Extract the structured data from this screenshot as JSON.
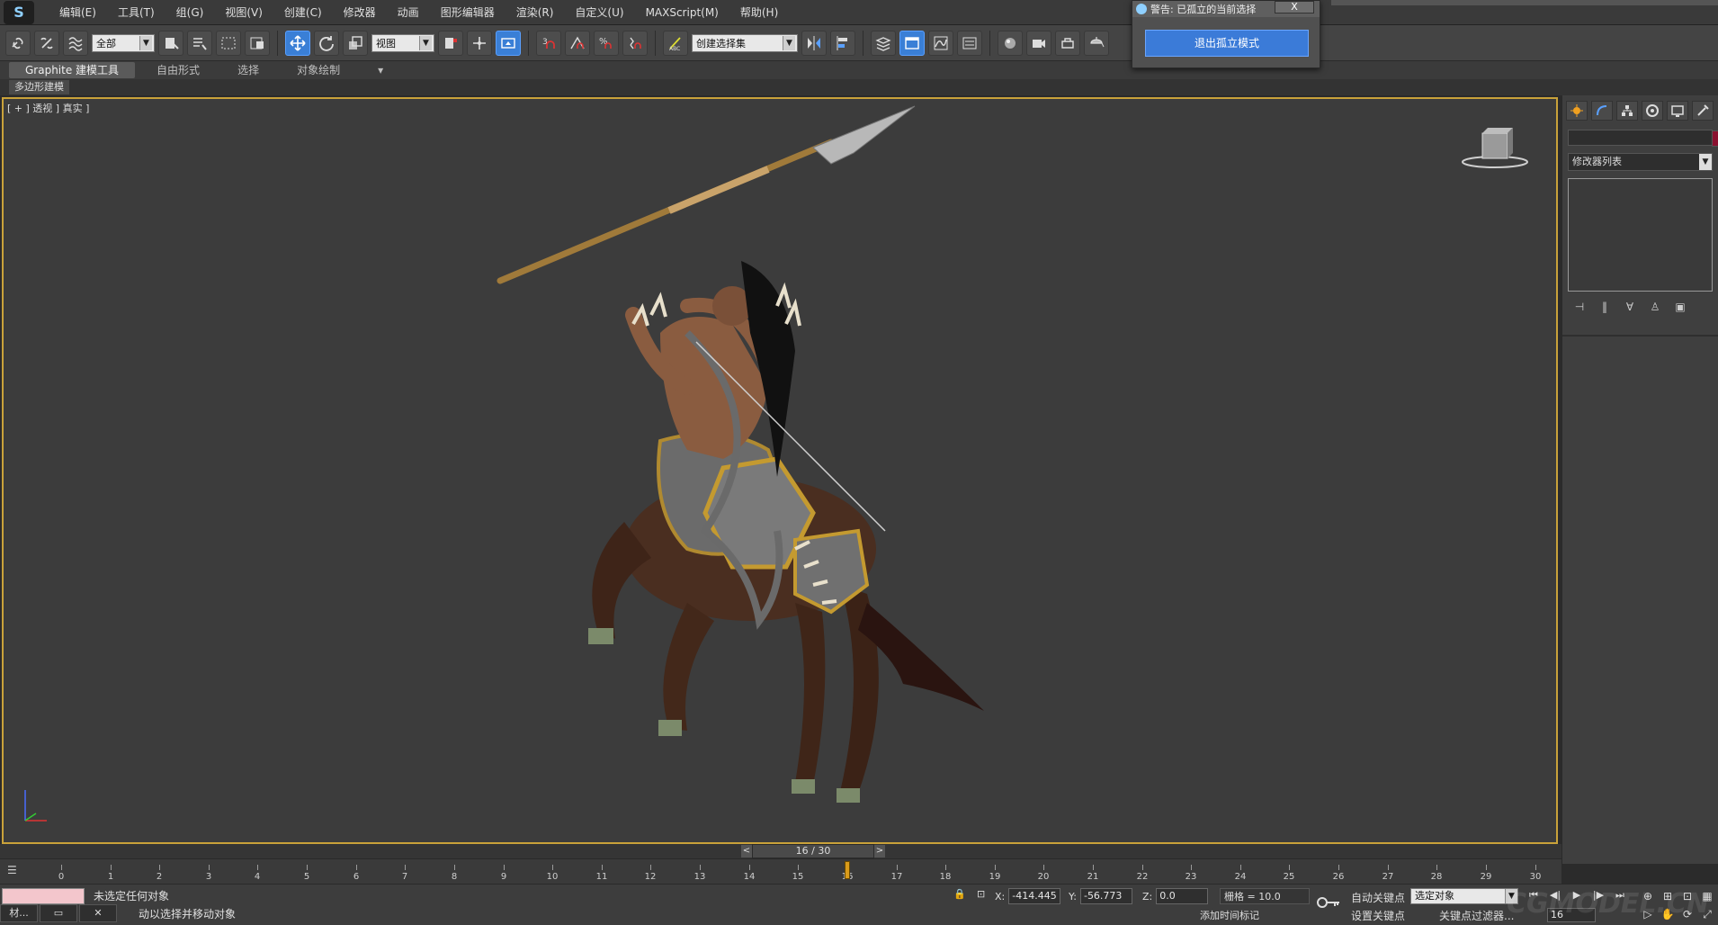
{
  "menu": {
    "items": [
      "编辑(E)",
      "工具(T)",
      "组(G)",
      "视图(V)",
      "创建(C)",
      "修改器",
      "动画",
      "图形编辑器",
      "渲染(R)",
      "自定义(U)",
      "MAXScript(M)",
      "帮助(H)"
    ]
  },
  "toolbar": {
    "selection_filter": "全部",
    "ref_coord": "视图",
    "named_selection": "创建选择集"
  },
  "ribbon": {
    "tabs": [
      "Graphite 建模工具",
      "自由形式",
      "选择",
      "对象绘制"
    ],
    "sub_label": "多边形建模"
  },
  "viewport": {
    "label": "[ + ] 透视 ] 真实 ]"
  },
  "dialog": {
    "title": "警告: 已孤立的当前选择",
    "close": "X",
    "button": "退出孤立模式"
  },
  "command_panel": {
    "modifier_list": "修改器列表"
  },
  "timeslider": {
    "frame_display": "16 / 30",
    "prev": "<",
    "next": ">",
    "current_frame": 16
  },
  "track": {
    "ticks": [
      "0",
      "1",
      "2",
      "3",
      "4",
      "5",
      "6",
      "7",
      "8",
      "9",
      "10",
      "11",
      "12",
      "13",
      "14",
      "15",
      "16",
      "17",
      "18",
      "19",
      "20",
      "21",
      "22",
      "23",
      "24",
      "25",
      "26",
      "27",
      "28",
      "29",
      "30"
    ]
  },
  "status": {
    "message1": "未选定任何对象",
    "message2": "动以选择并移动对象",
    "task1": "材...",
    "x_label": "X:",
    "x_value": "-414.445",
    "y_label": "Y:",
    "y_value": "-56.773",
    "z_label": "Z:",
    "z_value": "0.0",
    "grid": "栅格 = 10.0",
    "add_time_tag": "添加时间标记",
    "auto_key": "自动关键点",
    "set_key": "设置关键点",
    "selection_set": "选定对象",
    "key_filter": "关键点过滤器...",
    "frame": "16"
  },
  "watermark": "CGMODEL.CN",
  "colors": {
    "accent": "#3b7bd8",
    "viewport_border": "#c9a23a",
    "object_color": "#8a1230",
    "time_marker": "#d99b1a"
  }
}
